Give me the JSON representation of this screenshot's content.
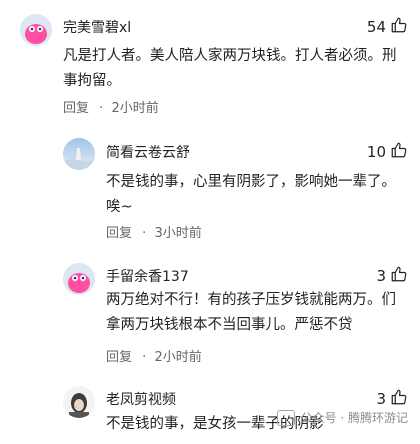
{
  "comments": [
    {
      "user": "完美雪碧xl",
      "likes": "54",
      "text": "凡是打人者。美人陪人家两万块钱。打人者必须。刑事拘留。",
      "reply_label": "回复",
      "time": "2小时前"
    },
    {
      "user": "简看云卷云舒",
      "likes": "10",
      "text": "不是钱的事，心里有阴影了，影响她一辈了。唉~",
      "reply_label": "回复",
      "time": "3小时前"
    },
    {
      "user": "手留余香137",
      "likes": "3",
      "text": "两万绝对不行！有的孩子压岁钱就能两万。们拿两万块钱根本不当回事儿。严惩不贷",
      "reply_label": "回复",
      "time": "2小时前"
    },
    {
      "user": "老凤剪视频",
      "likes": "3",
      "text": "不是钱的事，是女孩一辈子的阴影",
      "reply_label": "",
      "time": ""
    }
  ],
  "watermark": {
    "text": "公众号 · 腾腾环游记"
  },
  "colors": {
    "accent_blue": "#1f6fe0",
    "meta_gray": "#666666"
  }
}
